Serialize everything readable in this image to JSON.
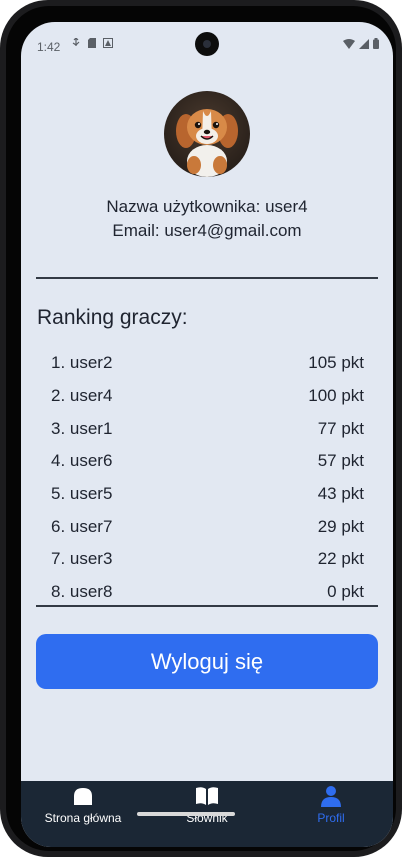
{
  "status_bar": {
    "time": "1:42"
  },
  "profile": {
    "username_line": "Nazwa użytkownika: user4",
    "email_line": "Email: user4@gmail.com"
  },
  "ranking": {
    "title": "Ranking graczy:",
    "rows": [
      {
        "name": "1. user2",
        "points": "105 pkt"
      },
      {
        "name": "2. user4",
        "points": "100 pkt"
      },
      {
        "name": "3. user1",
        "points": "77 pkt"
      },
      {
        "name": "4. user6",
        "points": "57 pkt"
      },
      {
        "name": "5. user5",
        "points": "43 pkt"
      },
      {
        "name": "6. user7",
        "points": "29 pkt"
      },
      {
        "name": "7. user3",
        "points": "22 pkt"
      },
      {
        "name": "8. user8",
        "points": "0 pkt"
      }
    ]
  },
  "logout": {
    "label": "Wyloguj się"
  },
  "bottom_nav": {
    "items": [
      {
        "label": "Strona główna",
        "icon": "home-icon",
        "active": false
      },
      {
        "label": "Słownik",
        "icon": "book-icon",
        "active": false
      },
      {
        "label": "Profil",
        "icon": "person-icon",
        "active": true
      }
    ]
  },
  "colors": {
    "background": "#e2e8f2",
    "accent": "#2f6df0",
    "nav_background": "#1b2735",
    "text": "#1f2430"
  }
}
